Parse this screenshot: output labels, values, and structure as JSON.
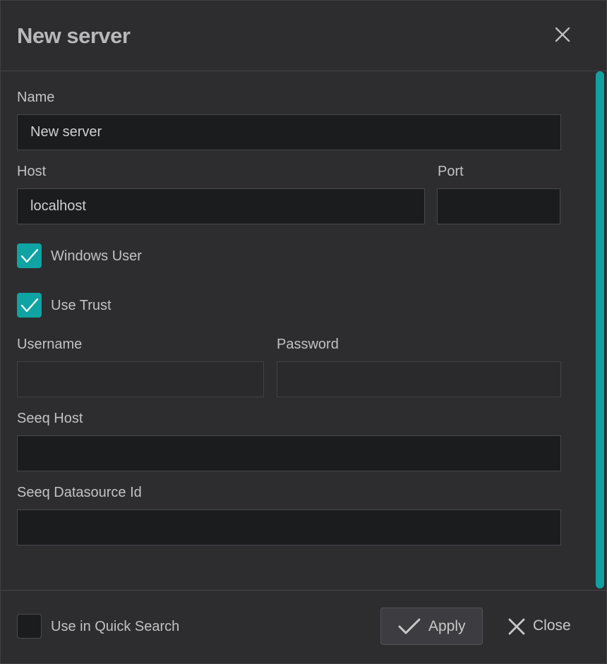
{
  "dialog": {
    "title": "New server"
  },
  "form": {
    "name_label": "Name",
    "name_value": "New server",
    "host_label": "Host",
    "host_value": "localhost",
    "port_label": "Port",
    "port_value": "",
    "windows_user_label": "Windows User",
    "windows_user_checked": true,
    "use_trust_label": "Use Trust",
    "use_trust_checked": true,
    "username_label": "Username",
    "username_value": "",
    "password_label": "Password",
    "password_value": "",
    "seeq_host_label": "Seeq Host",
    "seeq_host_value": "",
    "seeq_datasource_label": "Seeq Datasource Id",
    "seeq_datasource_value": ""
  },
  "footer": {
    "quick_search_label": "Use in Quick Search",
    "quick_search_checked": false,
    "apply_label": "Apply",
    "close_label": "Close"
  },
  "colors": {
    "accent": "#10a3a3",
    "background": "#2d2d30",
    "input_bg": "#1b1c1e",
    "text": "#c2c2c2"
  },
  "icons": {
    "dialog_close": "close-icon",
    "checkbox_mark": "checkmark-icon",
    "apply": "checkmark-icon",
    "close": "close-icon"
  }
}
